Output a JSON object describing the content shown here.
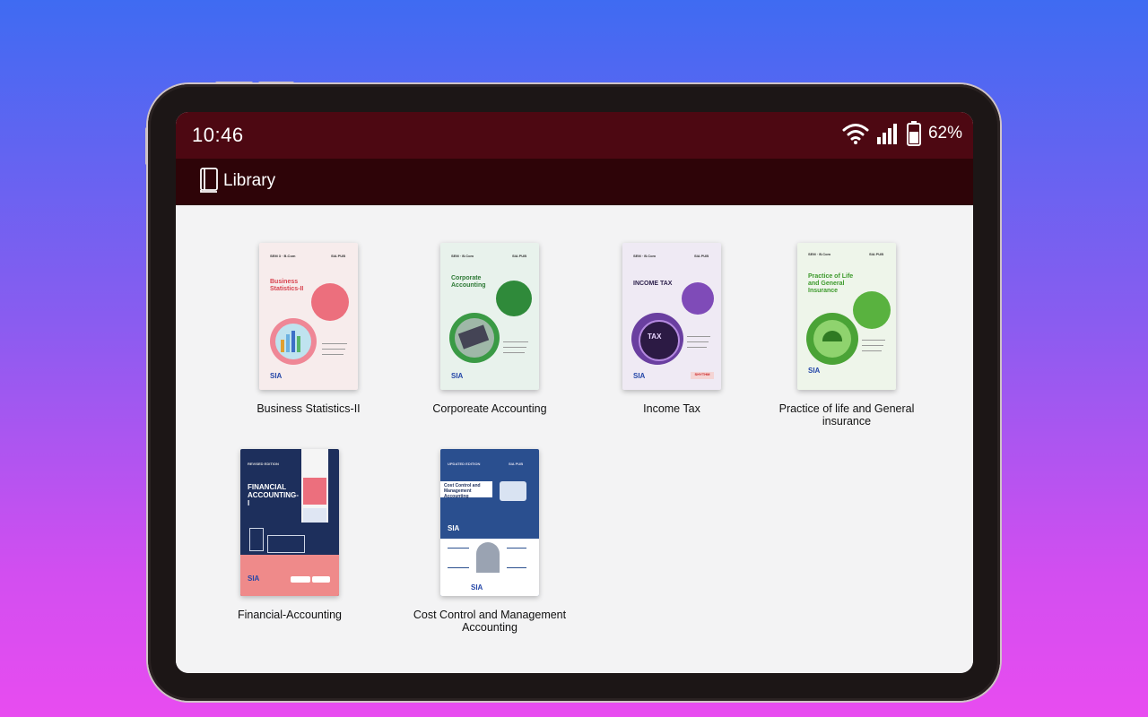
{
  "status_bar": {
    "time": "10:46",
    "battery_percent": "62%",
    "icons": [
      "wifi-icon",
      "signal-icon",
      "battery-icon"
    ]
  },
  "app_bar": {
    "icon": "book-icon",
    "title": "Library"
  },
  "books": [
    {
      "title": "Business Statistics-II",
      "cover_heading": "Business Statistics-II",
      "accent": "#e2586a"
    },
    {
      "title": "Corporeate Accounting",
      "cover_heading": "Corporate Accounting",
      "accent": "#2f8a3a"
    },
    {
      "title": "Income Tax",
      "cover_heading": "INCOME TAX",
      "accent": "#6a3fa0"
    },
    {
      "title": "Practice of life and General insurance",
      "cover_heading": "Practice of Life and General Insurance",
      "accent": "#4aa336"
    },
    {
      "title": "Financial-Accounting",
      "cover_heading": "FINANCIAL ACCOUNTING-I",
      "accent": "#1d2f5c"
    },
    {
      "title": "Cost Control and Management Accounting",
      "cover_heading": "Cost Control and Management Accounting",
      "accent": "#2a4f8f"
    }
  ],
  "colors": {
    "status_bar": "#4d0812",
    "app_bar": "#2e0408",
    "content_bg": "#f3f3f4"
  }
}
